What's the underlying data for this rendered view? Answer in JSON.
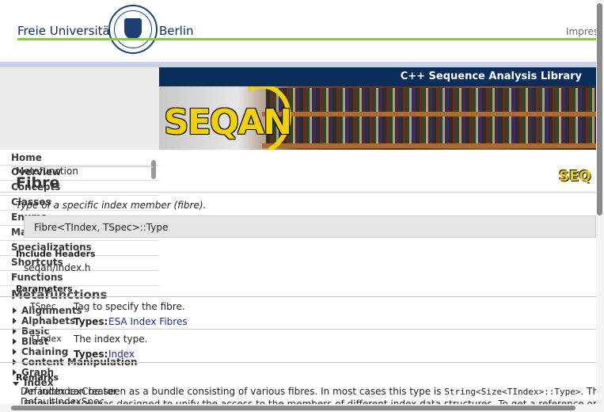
{
  "header": {
    "university_left": "Freie Universität",
    "university_right": "Berlin",
    "impressum": "Impres",
    "banner_title": "C++ Sequence Analysis Library",
    "logo_text": "SEQAN",
    "small_logo": "SEQ"
  },
  "sidebar": {
    "items": [
      "Home",
      "Overview",
      "Concepts",
      "Classes",
      "Enums",
      "Macros",
      "Specializations",
      "Shortcuts",
      "Functions"
    ],
    "meta_heading": "Metafunctions",
    "subitems": [
      "Alignments",
      "Alphabets",
      "Basic",
      "Blast",
      "Chaining",
      "Content Manipulation",
      "Graph",
      "Index"
    ],
    "overlap_texts": [
      "Metafunction",
      "DefaultIndexCreator",
      "DefaultIndexSpec"
    ]
  },
  "content": {
    "title": "Fibre",
    "description": "Type of a specific index member (fibre).",
    "signature": "Fibre<TIndex, TSpec>::Type",
    "include_heading": "Include Headers",
    "include_file": "seqan/index.h",
    "params_heading": "Parameters",
    "params": [
      {
        "name": "TSpec",
        "desc": "Tag to specify the fibre.",
        "types_label": "Types:",
        "types_value": "ESA Index Fibres"
      },
      {
        "name": "TIndex",
        "desc": "The index type.",
        "types_label": "Types:",
        "types_value": "Index"
      }
    ],
    "remarks_heading": "Remarks",
    "remarks_text_1": "An index can be seen as a bundle consisting of various fibres. In most cases this type is",
    "remarks_code": "String<Size<TIndex>::Type>",
    "remarks_end": ". The",
    "remarks_text_2": "Fibre interface was designed to unify the access to the members of different index data structures. To get a reference or the"
  }
}
